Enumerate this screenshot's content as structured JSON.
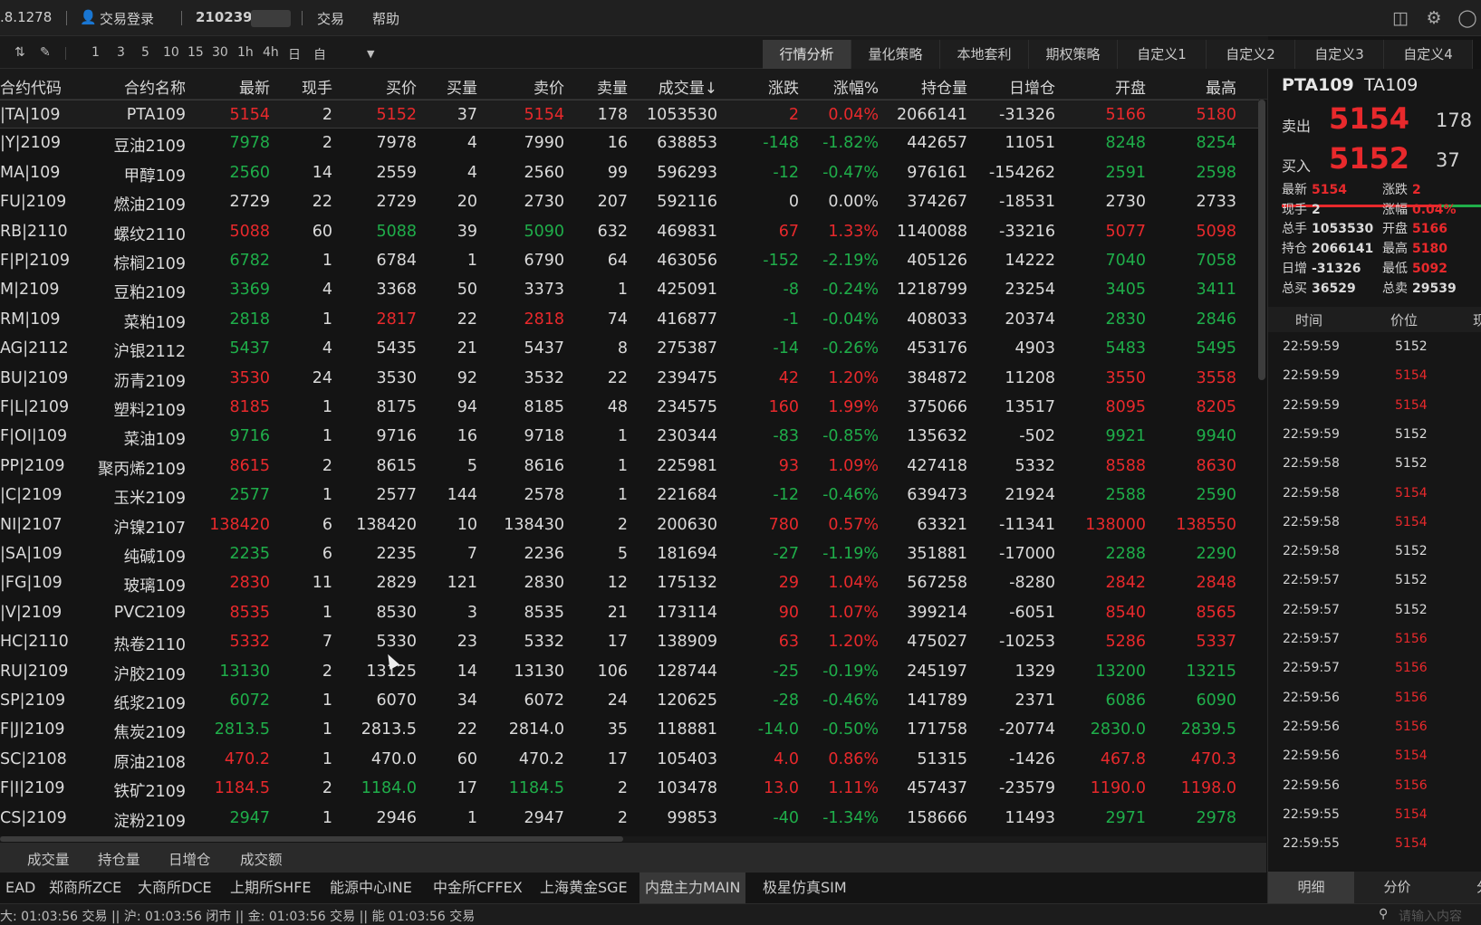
{
  "topbar": {
    "version": ".8.1278",
    "login_label": "交易登录",
    "account": "210239",
    "trade_label": "交易",
    "help_label": "帮助"
  },
  "toolbar": {
    "periods": [
      "1",
      "3",
      "5",
      "10",
      "15",
      "30",
      "1h",
      "4h",
      "日",
      "自"
    ]
  },
  "tabs": [
    {
      "label": "行情分析",
      "active": true
    },
    {
      "label": "量化策略",
      "active": false
    },
    {
      "label": "本地套利",
      "active": false
    },
    {
      "label": "期权策略",
      "active": false
    },
    {
      "label": "自定义1",
      "active": false
    },
    {
      "label": "自定义2",
      "active": false
    },
    {
      "label": "自定义3",
      "active": false
    },
    {
      "label": "自定义4",
      "active": false
    }
  ],
  "table": {
    "columns": [
      "合约代码",
      "合约名称",
      "最新",
      "现手",
      "买价",
      "买量",
      "卖价",
      "卖量",
      "成交量↓",
      "涨跌",
      "涨幅%",
      "持仓量",
      "日增仓",
      "开盘",
      "最高"
    ],
    "rows": [
      {
        "c": [
          "|TA|109",
          "PTA109",
          "5154",
          "2",
          "5152",
          "37",
          "5154",
          "178",
          "1053530",
          "2",
          "0.04%",
          "2066141",
          "-31326",
          "5166",
          "5180"
        ],
        "k": [
          "",
          "",
          "r",
          "",
          "r",
          "",
          "r",
          "",
          "",
          "r",
          "r",
          "",
          "",
          "r",
          "r"
        ]
      },
      {
        "c": [
          "|Y|2109",
          "豆油2109",
          "7978",
          "2",
          "7978",
          "4",
          "7990",
          "16",
          "638853",
          "-148",
          "-1.82%",
          "442657",
          "11051",
          "8248",
          "8254"
        ],
        "k": [
          "",
          "",
          "g",
          "",
          "",
          "",
          "",
          "",
          "",
          "g",
          "g",
          "",
          "",
          "g",
          "g"
        ]
      },
      {
        "c": [
          "MA|109",
          "甲醇109",
          "2560",
          "14",
          "2559",
          "4",
          "2560",
          "99",
          "596293",
          "-12",
          "-0.47%",
          "976161",
          "-154262",
          "2591",
          "2598"
        ],
        "k": [
          "",
          "",
          "g",
          "",
          "",
          "",
          "",
          "",
          "",
          "g",
          "g",
          "",
          "",
          "g",
          "g"
        ]
      },
      {
        "c": [
          "FU|2109",
          "燃油2109",
          "2729",
          "22",
          "2729",
          "20",
          "2730",
          "207",
          "592116",
          "0",
          "0.00%",
          "374267",
          "-18531",
          "2730",
          "2733"
        ],
        "k": [
          "",
          "",
          "",
          "",
          "",
          "",
          "",
          "",
          "",
          "",
          "",
          "",
          "",
          "",
          ""
        ]
      },
      {
        "c": [
          "RB|2110",
          "螺纹2110",
          "5088",
          "60",
          "5088",
          "39",
          "5090",
          "632",
          "469831",
          "67",
          "1.33%",
          "1140088",
          "-33216",
          "5077",
          "5098"
        ],
        "k": [
          "",
          "",
          "r",
          "",
          "g",
          "",
          "g",
          "",
          "",
          "r",
          "r",
          "",
          "",
          "r",
          "r"
        ]
      },
      {
        "c": [
          "F|P|2109",
          "棕榈2109",
          "6782",
          "1",
          "6784",
          "1",
          "6790",
          "64",
          "463056",
          "-152",
          "-2.19%",
          "405126",
          "14222",
          "7040",
          "7058"
        ],
        "k": [
          "",
          "",
          "g",
          "",
          "",
          "",
          "",
          "",
          "",
          "g",
          "g",
          "",
          "",
          "g",
          "g"
        ]
      },
      {
        "c": [
          "M|2109",
          "豆粕2109",
          "3369",
          "4",
          "3368",
          "50",
          "3373",
          "1",
          "425091",
          "-8",
          "-0.24%",
          "1218799",
          "23254",
          "3405",
          "3411"
        ],
        "k": [
          "",
          "",
          "g",
          "",
          "",
          "",
          "",
          "",
          "",
          "g",
          "g",
          "",
          "",
          "g",
          "g"
        ]
      },
      {
        "c": [
          "RM|109",
          "菜粕109",
          "2818",
          "1",
          "2817",
          "22",
          "2818",
          "74",
          "416877",
          "-1",
          "-0.04%",
          "408033",
          "20374",
          "2830",
          "2846"
        ],
        "k": [
          "",
          "",
          "g",
          "",
          "r",
          "",
          "r",
          "",
          "",
          "g",
          "g",
          "",
          "",
          "g",
          "g"
        ]
      },
      {
        "c": [
          "AG|2112",
          "沪银2112",
          "5437",
          "4",
          "5435",
          "21",
          "5437",
          "8",
          "275387",
          "-14",
          "-0.26%",
          "453176",
          "4903",
          "5483",
          "5495"
        ],
        "k": [
          "",
          "",
          "g",
          "",
          "",
          "",
          "",
          "",
          "",
          "g",
          "g",
          "",
          "",
          "g",
          "g"
        ]
      },
      {
        "c": [
          "BU|2109",
          "沥青2109",
          "3530",
          "24",
          "3530",
          "92",
          "3532",
          "22",
          "239475",
          "42",
          "1.20%",
          "384872",
          "11208",
          "3550",
          "3558"
        ],
        "k": [
          "",
          "",
          "r",
          "",
          "",
          "",
          "",
          "",
          "",
          "r",
          "r",
          "",
          "",
          "r",
          "r"
        ]
      },
      {
        "c": [
          "F|L|2109",
          "塑料2109",
          "8185",
          "1",
          "8175",
          "94",
          "8185",
          "48",
          "234575",
          "160",
          "1.99%",
          "375066",
          "13517",
          "8095",
          "8205"
        ],
        "k": [
          "",
          "",
          "r",
          "",
          "",
          "",
          "",
          "",
          "",
          "r",
          "r",
          "",
          "",
          "r",
          "r"
        ]
      },
      {
        "c": [
          "F|OI|109",
          "菜油109",
          "9716",
          "1",
          "9716",
          "16",
          "9718",
          "1",
          "230344",
          "-83",
          "-0.85%",
          "135632",
          "-502",
          "9921",
          "9940"
        ],
        "k": [
          "",
          "",
          "g",
          "",
          "",
          "",
          "",
          "",
          "",
          "g",
          "g",
          "",
          "",
          "g",
          "g"
        ]
      },
      {
        "c": [
          "PP|2109",
          "聚丙烯2109",
          "8615",
          "2",
          "8615",
          "5",
          "8616",
          "1",
          "225981",
          "93",
          "1.09%",
          "427418",
          "5332",
          "8588",
          "8630"
        ],
        "k": [
          "",
          "",
          "r",
          "",
          "",
          "",
          "",
          "",
          "",
          "r",
          "r",
          "",
          "",
          "r",
          "r"
        ]
      },
      {
        "c": [
          "|C|2109",
          "玉米2109",
          "2577",
          "1",
          "2577",
          "144",
          "2578",
          "1",
          "221684",
          "-12",
          "-0.46%",
          "639473",
          "21924",
          "2588",
          "2590"
        ],
        "k": [
          "",
          "",
          "g",
          "",
          "",
          "",
          "",
          "",
          "",
          "g",
          "g",
          "",
          "",
          "g",
          "g"
        ]
      },
      {
        "c": [
          "NI|2107",
          "沪镍2107",
          "138420",
          "6",
          "138420",
          "10",
          "138430",
          "2",
          "200630",
          "780",
          "0.57%",
          "63321",
          "-11341",
          "138000",
          "138550"
        ],
        "k": [
          "",
          "",
          "r",
          "",
          "",
          "",
          "",
          "",
          "",
          "r",
          "r",
          "",
          "",
          "r",
          "r"
        ]
      },
      {
        "c": [
          "|SA|109",
          "纯碱109",
          "2235",
          "6",
          "2235",
          "7",
          "2236",
          "5",
          "181694",
          "-27",
          "-1.19%",
          "351881",
          "-17000",
          "2288",
          "2290"
        ],
        "k": [
          "",
          "",
          "g",
          "",
          "",
          "",
          "",
          "",
          "",
          "g",
          "g",
          "",
          "",
          "g",
          "g"
        ]
      },
      {
        "c": [
          "|FG|109",
          "玻璃109",
          "2830",
          "11",
          "2829",
          "121",
          "2830",
          "12",
          "175132",
          "29",
          "1.04%",
          "567258",
          "-8280",
          "2842",
          "2848"
        ],
        "k": [
          "",
          "",
          "r",
          "",
          "",
          "",
          "",
          "",
          "",
          "r",
          "r",
          "",
          "",
          "r",
          "r"
        ]
      },
      {
        "c": [
          "|V|2109",
          "PVC2109",
          "8535",
          "1",
          "8530",
          "3",
          "8535",
          "21",
          "173114",
          "90",
          "1.07%",
          "399214",
          "-6051",
          "8540",
          "8565"
        ],
        "k": [
          "",
          "",
          "r",
          "",
          "",
          "",
          "",
          "",
          "",
          "r",
          "r",
          "",
          "",
          "r",
          "r"
        ]
      },
      {
        "c": [
          "HC|2110",
          "热卷2110",
          "5332",
          "7",
          "5330",
          "23",
          "5332",
          "17",
          "138909",
          "63",
          "1.20%",
          "475027",
          "-10253",
          "5286",
          "5337"
        ],
        "k": [
          "",
          "",
          "r",
          "",
          "",
          "",
          "",
          "",
          "",
          "r",
          "r",
          "",
          "",
          "r",
          "r"
        ]
      },
      {
        "c": [
          "RU|2109",
          "沪胶2109",
          "13130",
          "2",
          "13125",
          "14",
          "13130",
          "106",
          "128744",
          "-25",
          "-0.19%",
          "245197",
          "1329",
          "13200",
          "13215"
        ],
        "k": [
          "",
          "",
          "g",
          "",
          "",
          "",
          "",
          "",
          "",
          "g",
          "g",
          "",
          "",
          "g",
          "g"
        ]
      },
      {
        "c": [
          "SP|2109",
          "纸浆2109",
          "6072",
          "1",
          "6070",
          "34",
          "6072",
          "24",
          "120625",
          "-28",
          "-0.46%",
          "141789",
          "2371",
          "6086",
          "6090"
        ],
        "k": [
          "",
          "",
          "g",
          "",
          "",
          "",
          "",
          "",
          "",
          "g",
          "g",
          "",
          "",
          "g",
          "g"
        ]
      },
      {
        "c": [
          "F|J|2109",
          "焦炭2109",
          "2813.5",
          "1",
          "2813.5",
          "22",
          "2814.0",
          "35",
          "118881",
          "-14.0",
          "-0.50%",
          "171758",
          "-20774",
          "2830.0",
          "2839.5"
        ],
        "k": [
          "",
          "",
          "g",
          "",
          "",
          "",
          "",
          "",
          "",
          "g",
          "g",
          "",
          "",
          "g",
          "g"
        ]
      },
      {
        "c": [
          "SC|2108",
          "原油2108",
          "470.2",
          "1",
          "470.0",
          "60",
          "470.2",
          "17",
          "105403",
          "4.0",
          "0.86%",
          "51315",
          "-1426",
          "467.8",
          "470.3"
        ],
        "k": [
          "",
          "",
          "r",
          "",
          "",
          "",
          "",
          "",
          "",
          "r",
          "r",
          "",
          "",
          "r",
          "r"
        ]
      },
      {
        "c": [
          "F|I|2109",
          "铁矿2109",
          "1184.5",
          "2",
          "1184.0",
          "17",
          "1184.5",
          "2",
          "103478",
          "13.0",
          "1.11%",
          "457437",
          "-23579",
          "1190.0",
          "1198.0"
        ],
        "k": [
          "",
          "",
          "r",
          "",
          "g",
          "",
          "g",
          "",
          "",
          "r",
          "r",
          "",
          "",
          "r",
          "r"
        ]
      },
      {
        "c": [
          "CS|2109",
          "淀粉2109",
          "2947",
          "1",
          "2946",
          "1",
          "2947",
          "2",
          "99853",
          "-40",
          "-1.34%",
          "158666",
          "11493",
          "2971",
          "2978"
        ],
        "k": [
          "",
          "",
          "g",
          "",
          "",
          "",
          "",
          "",
          "",
          "g",
          "g",
          "",
          "",
          "g",
          "g"
        ]
      }
    ]
  },
  "subtabs": [
    "成交量",
    "持仓量",
    "日增仓",
    "成交额"
  ],
  "exchanges": [
    {
      "label": "EAD",
      "active": false
    },
    {
      "label": "郑商所ZCE",
      "active": false
    },
    {
      "label": "大商所DCE",
      "active": false
    },
    {
      "label": "上期所SHFE",
      "active": false
    },
    {
      "label": "能源中心INE",
      "active": false
    },
    {
      "label": "中金所CFFEX",
      "active": false
    },
    {
      "label": "上海黄金SGE",
      "active": false
    },
    {
      "label": "内盘主力MAIN",
      "active": true
    },
    {
      "label": "极星仿真SIM",
      "active": false
    }
  ],
  "statusbar": {
    "text": "大: 01:03:56 交易 || 沪: 01:03:56 闭市 || 金: 01:03:56 交易 || 能 01:03:56 交易"
  },
  "quote": {
    "name": "PTA109",
    "code": "TA109",
    "sell_label": "卖出",
    "sell_price": "5154",
    "sell_vol": "178",
    "buy_label": "买入",
    "buy_price": "5152",
    "buy_vol": "37",
    "fields": [
      {
        "k": "最新",
        "v": "5154",
        "c": "red"
      },
      {
        "k": "涨跌",
        "v": "2",
        "c": "red"
      },
      {
        "k": "现手",
        "v": "2",
        "c": "white"
      },
      {
        "k": "涨幅",
        "v": "0.04%",
        "c": "red"
      },
      {
        "k": "总手",
        "v": "1053530",
        "c": "white"
      },
      {
        "k": "开盘",
        "v": "5166",
        "c": "red"
      },
      {
        "k": "持仓",
        "v": "2066141",
        "c": "white"
      },
      {
        "k": "最高",
        "v": "5180",
        "c": "red"
      },
      {
        "k": "日增",
        "v": "-31326",
        "c": "white"
      },
      {
        "k": "最低",
        "v": "5092",
        "c": "red"
      },
      {
        "k": "总买",
        "v": "36529",
        "c": "white"
      },
      {
        "k": "总卖",
        "v": "29539",
        "c": "white"
      }
    ],
    "tick_headers": [
      "时间",
      "价位",
      "现"
    ],
    "ticks": [
      {
        "t": "22:59:59",
        "p": "5152",
        "c": "white"
      },
      {
        "t": "22:59:59",
        "p": "5154",
        "c": "red"
      },
      {
        "t": "22:59:59",
        "p": "5154",
        "c": "red"
      },
      {
        "t": "22:59:59",
        "p": "5152",
        "c": "white"
      },
      {
        "t": "22:59:58",
        "p": "5152",
        "c": "white"
      },
      {
        "t": "22:59:58",
        "p": "5154",
        "c": "red"
      },
      {
        "t": "22:59:58",
        "p": "5154",
        "c": "red"
      },
      {
        "t": "22:59:58",
        "p": "5152",
        "c": "white"
      },
      {
        "t": "22:59:57",
        "p": "5152",
        "c": "white"
      },
      {
        "t": "22:59:57",
        "p": "5152",
        "c": "white"
      },
      {
        "t": "22:59:57",
        "p": "5156",
        "c": "red"
      },
      {
        "t": "22:59:57",
        "p": "5156",
        "c": "red"
      },
      {
        "t": "22:59:56",
        "p": "5156",
        "c": "red"
      },
      {
        "t": "22:59:56",
        "p": "5156",
        "c": "red"
      },
      {
        "t": "22:59:56",
        "p": "5154",
        "c": "red"
      },
      {
        "t": "22:59:56",
        "p": "5156",
        "c": "red"
      },
      {
        "t": "22:59:55",
        "p": "5154",
        "c": "red"
      },
      {
        "t": "22:59:55",
        "p": "5154",
        "c": "red"
      }
    ],
    "bottom_tabs": [
      {
        "label": "明细",
        "active": true
      },
      {
        "label": "分价",
        "active": false
      },
      {
        "label": "分",
        "active": false
      }
    ]
  },
  "search": {
    "placeholder": "请输入内容"
  },
  "colors": {
    "up": "#e8292c",
    "down": "#1fae4a",
    "flat": "#dadada",
    "bg": "#141414"
  }
}
